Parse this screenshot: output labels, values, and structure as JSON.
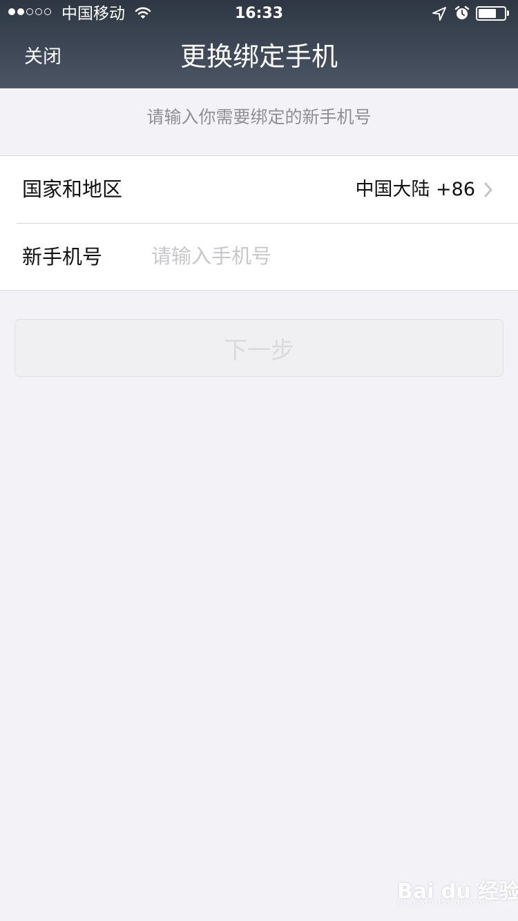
{
  "status_bar": {
    "carrier": "中国移动",
    "time": "16:33",
    "signal_bars_filled": 2,
    "signal_bars_total": 5,
    "battery_level": 0.7,
    "icons": [
      "wifi-icon",
      "location-arrow-icon",
      "alarm-icon",
      "battery-icon"
    ]
  },
  "nav": {
    "close_label": "关闭",
    "title": "更换绑定手机"
  },
  "hint": "请输入你需要绑定的新手机号",
  "form": {
    "region_label": "国家和地区",
    "region_value": "中国大陆 +86",
    "phone_label": "新手机号",
    "phone_placeholder": "请输入手机号",
    "phone_value": ""
  },
  "next_button": {
    "label": "下一步",
    "enabled": false
  },
  "watermark": {
    "main": "Bai du 经验",
    "sub": "jingyan.baidu.com"
  },
  "colors": {
    "nav_background": "#3a4250",
    "page_background": "#f2f2f7",
    "hint_text": "#8e8e93",
    "placeholder_text": "#c7c7cd",
    "disabled_button_text": "#dadade"
  }
}
